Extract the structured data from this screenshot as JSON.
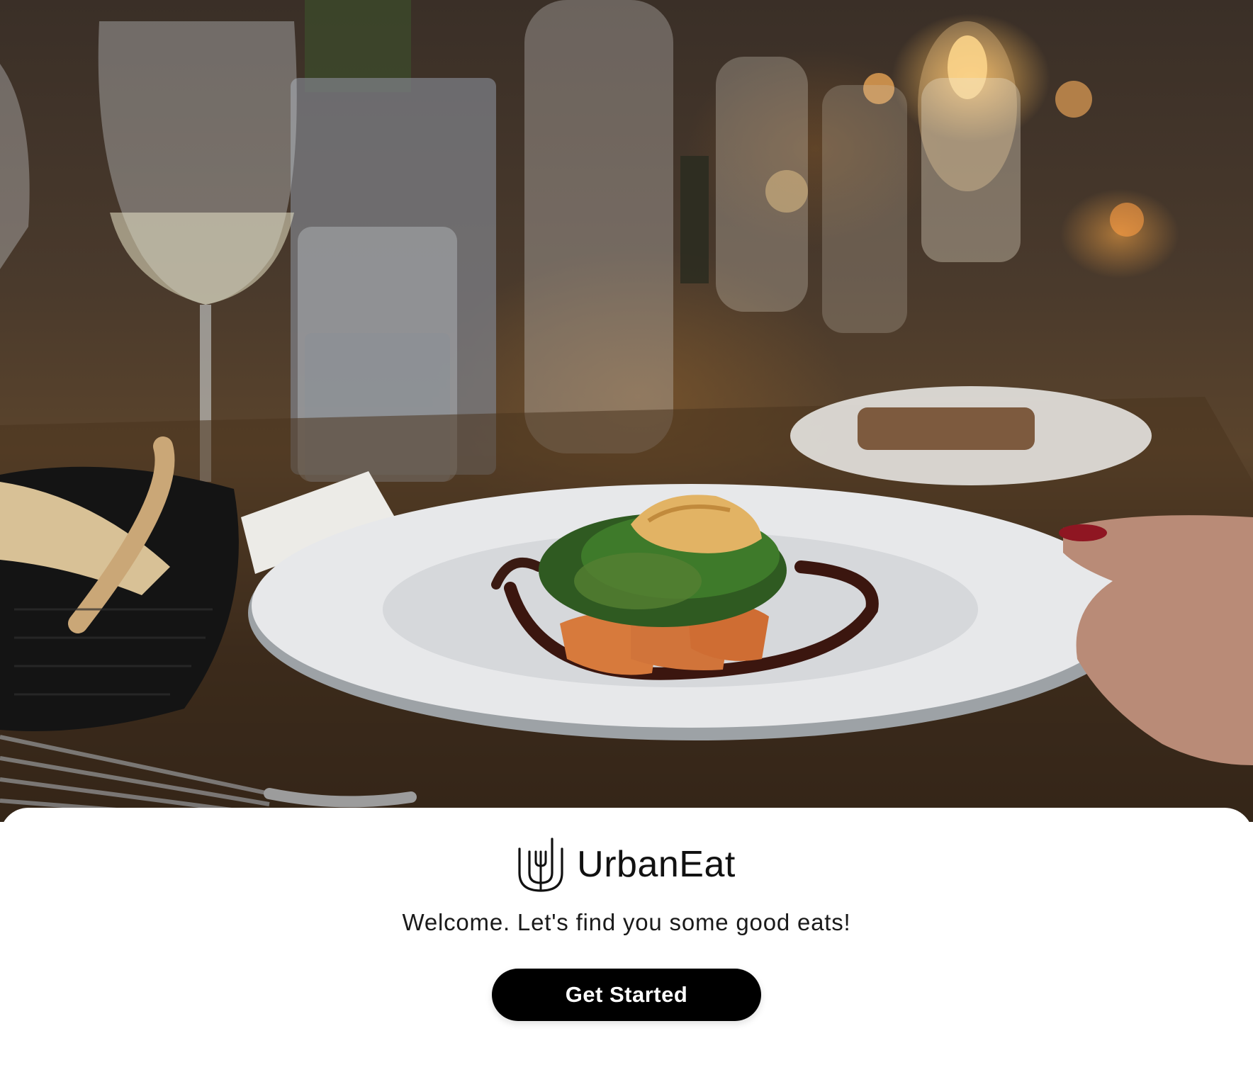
{
  "hero": {
    "image_icon": "restaurant-plated-dish-photo"
  },
  "brand": {
    "logo_icon": "fork-in-u-logo-icon",
    "name": "UrbanEat"
  },
  "tagline": "Welcome. Let's find you some good eats!",
  "cta": {
    "label": "Get Started",
    "background": "#000000",
    "text_color": "#ffffff"
  }
}
